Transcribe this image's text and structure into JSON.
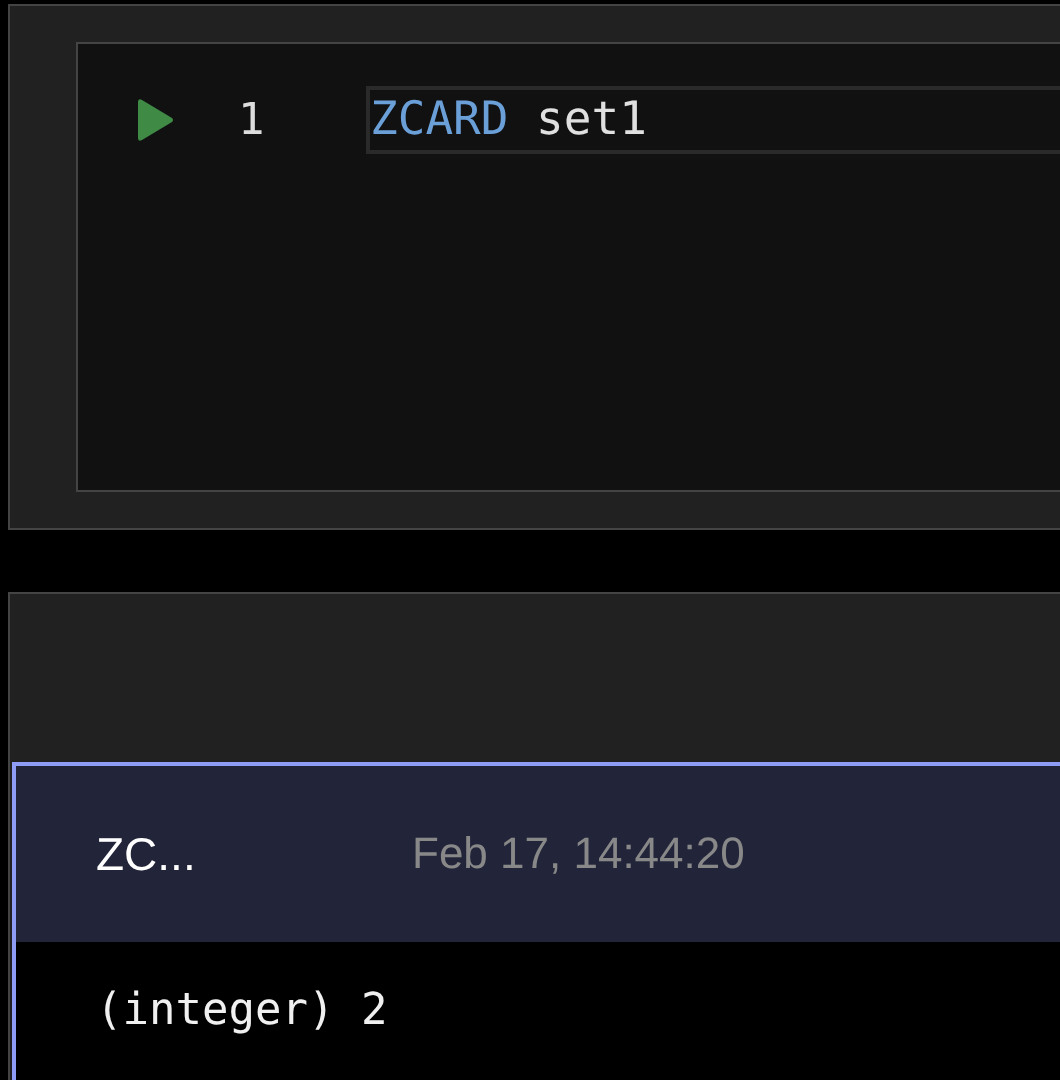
{
  "editor": {
    "lines": [
      {
        "number": "1",
        "keyword": "ZCARD",
        "args": "set1",
        "runnable": true
      }
    ]
  },
  "results": [
    {
      "command": "ZC...",
      "time": "Feb 17, 14:44:20",
      "output": "(integer) 2",
      "selected": true
    }
  ]
}
